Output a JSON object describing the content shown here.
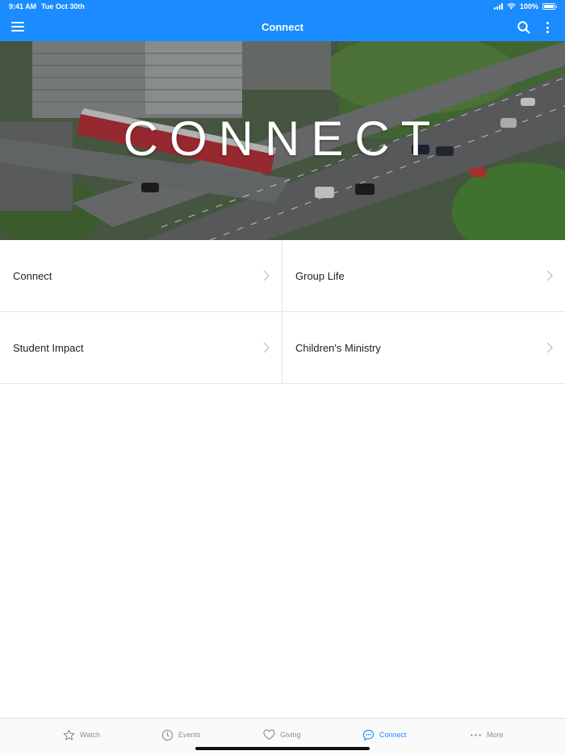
{
  "status_bar": {
    "time": "9:41 AM",
    "date": "Tue Oct 30th",
    "battery": "100%"
  },
  "nav": {
    "title": "Connect",
    "menu_icon": "hamburger-icon",
    "search_icon": "search-icon",
    "more_icon": "kebab-icon"
  },
  "hero": {
    "text": "CONNECT"
  },
  "tiles": [
    {
      "label": "Connect"
    },
    {
      "label": "Group Life"
    },
    {
      "label": "Student Impact"
    },
    {
      "label": "Children's Ministry"
    }
  ],
  "tabs": [
    {
      "label": "Watch",
      "icon": "star-icon",
      "active": false
    },
    {
      "label": "Events",
      "icon": "clock-icon",
      "active": false
    },
    {
      "label": "Giving",
      "icon": "heart-icon",
      "active": false
    },
    {
      "label": "Connect",
      "icon": "chat-bubble-icon",
      "active": true
    },
    {
      "label": "More",
      "icon": "ellipsis-icon",
      "active": false
    }
  ],
  "colors": {
    "accent": "#1a8cff",
    "tab_inactive": "#8e8e8e"
  }
}
